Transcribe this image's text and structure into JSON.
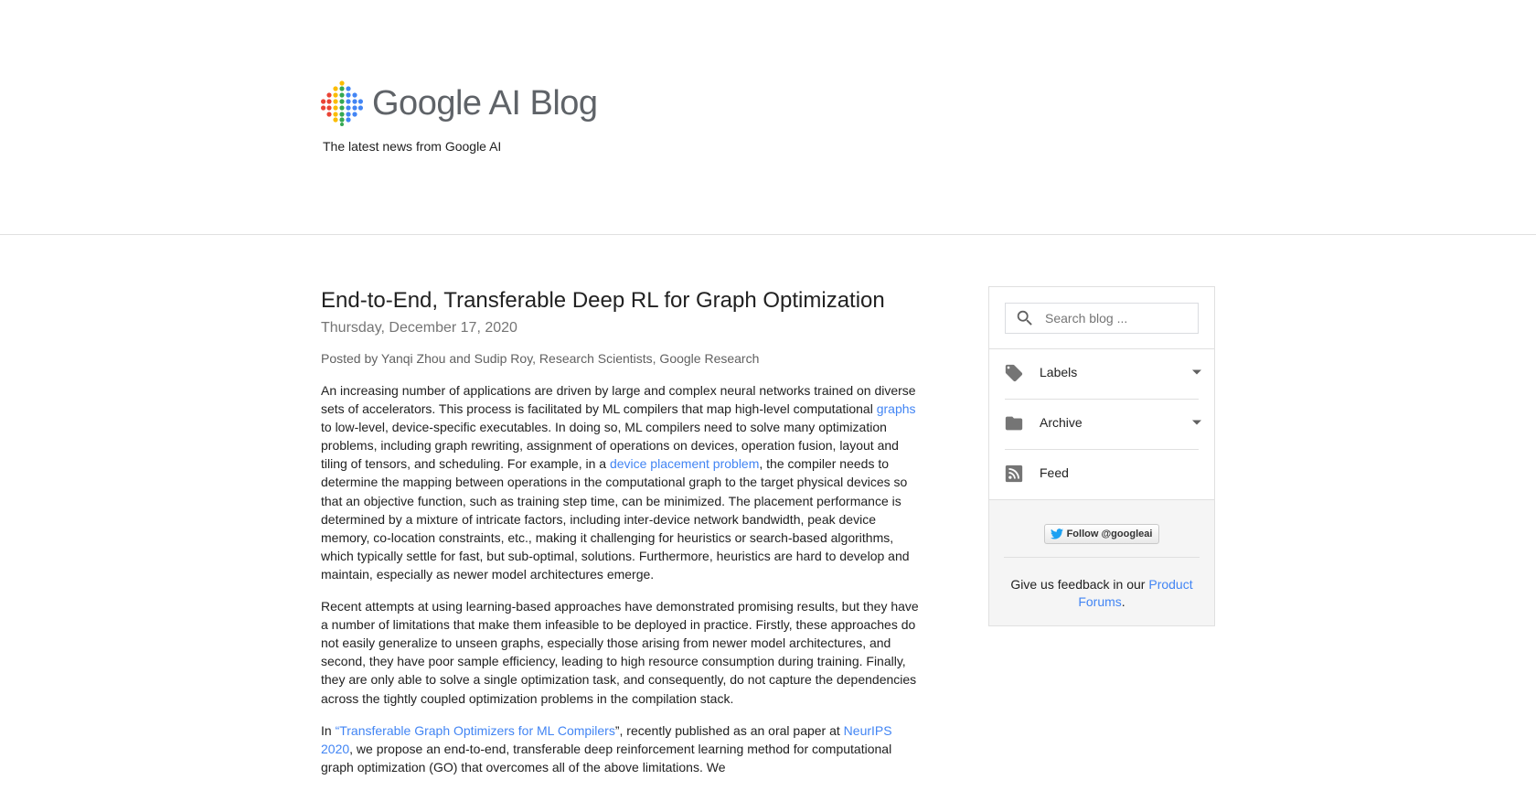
{
  "header": {
    "logo_word_google": "Google",
    "logo_word_ai_blog": "AI Blog",
    "tagline": "The latest news from Google AI"
  },
  "post": {
    "title": "End-to-End, Transferable Deep RL for Graph Optimization",
    "date": "Thursday, December 17, 2020",
    "author": "Posted by Yanqi Zhou and Sudip Roy, Research Scientists, Google Research",
    "p1": {
      "t1": "An increasing number of applications are driven by large and complex neural networks trained on diverse sets of accelerators. This process is facilitated by ML compilers that map high-level computational ",
      "link1": "graphs",
      "t2": " to low-level, device-specific executables. In doing so, ML compilers need to solve many optimization problems, including graph rewriting, assignment of operations on devices, operation fusion, layout and tiling of tensors, and scheduling. For example, in a ",
      "link2": "device placement problem",
      "t3": ", the compiler needs to determine the mapping between operations in the computational graph to the target physical devices so that an objective function, such as training step time, can be minimized. The placement performance is determined by a mixture of intricate factors, including inter-device network bandwidth, peak device memory, co-location constraints, etc., making it challenging for heuristics or search-based algorithms, which typically settle for fast, but sub-optimal, solutions. Furthermore, heuristics are hard to develop and maintain, especially as newer model architectures emerge."
    },
    "p2": "Recent attempts at using learning-based approaches have demonstrated promising results, but they have a number of limitations that make them infeasible to be deployed in practice. Firstly, these approaches do not easily generalize to unseen graphs, especially those arising from newer model architectures, and second, they have poor sample efficiency, leading to high resource consumption during training. Finally, they are only able to solve a single optimization task, and consequently, do not capture the dependencies across the tightly coupled optimization problems in the compilation stack.",
    "p3": {
      "t1": "In ",
      "link1": "“Transferable Graph Optimizers for ML Compilers",
      "t2": "”, recently published as an oral paper at ",
      "link2": "NeurIPS 2020",
      "t3": ", we propose an end-to-end, transferable deep reinforcement learning method for computational graph optimization (GO) that overcomes all of the above limitations. We"
    }
  },
  "sidebar": {
    "search_placeholder": "Search blog ...",
    "labels": "Labels",
    "archive": "Archive",
    "feed": "Feed",
    "follow_label": "Follow @googleai",
    "feedback_text": "Give us feedback in our ",
    "feedback_link": "Product Forums",
    "feedback_end": "."
  },
  "colors": {
    "link": "#4285f4",
    "text": "#212121",
    "muted": "#757575"
  }
}
